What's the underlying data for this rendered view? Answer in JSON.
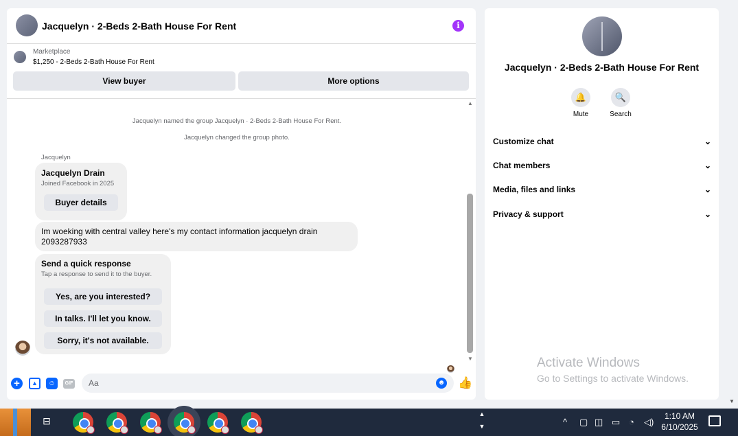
{
  "header": {
    "title": "Jacquelyn · 2-Beds 2-Bath House For Rent",
    "info_icon": "i"
  },
  "marketplace": {
    "label": "Marketplace",
    "listing": "$1,250 - 2-Beds 2-Bath House For Rent",
    "view_buyer": "View buyer",
    "more_options": "More options"
  },
  "messages": {
    "system": [
      "Jacquelyn named the group Jacquelyn · 2-Beds 2-Bath House For Rent.",
      "Jacquelyn changed the group photo."
    ],
    "sender": "Jacquelyn",
    "profile_card": {
      "name": "Jacquelyn Drain",
      "joined": "Joined Facebook in 2025",
      "button": "Buyer details"
    },
    "text": "Im woeking with central valley here's my contact information jacquelyn drain 2093287933",
    "quick": {
      "title": "Send a quick response",
      "subtitle": "Tap a response to send it to the buyer.",
      "options": [
        "Yes, are you interested?",
        "In talks. I'll let you know.",
        "Sorry, it's not available."
      ]
    }
  },
  "composer": {
    "placeholder": "Aa",
    "gif": "GIF"
  },
  "info_panel": {
    "title": "Jacquelyn · 2-Beds 2-Bath House For Rent",
    "actions": [
      {
        "label": "Mute",
        "icon": "bell-icon"
      },
      {
        "label": "Search",
        "icon": "search-icon"
      }
    ],
    "sections": [
      "Customize chat",
      "Chat members",
      "Media, files and links",
      "Privacy & support"
    ]
  },
  "watermark": {
    "line1": "Activate Windows",
    "line2": "Go to Settings to activate Windows."
  },
  "taskbar": {
    "time": "1:10 AM",
    "date": "6/10/2025"
  },
  "colors": {
    "accent": "#0866ff",
    "info": "#a334fa",
    "taskbar": "#1f2a3d"
  }
}
